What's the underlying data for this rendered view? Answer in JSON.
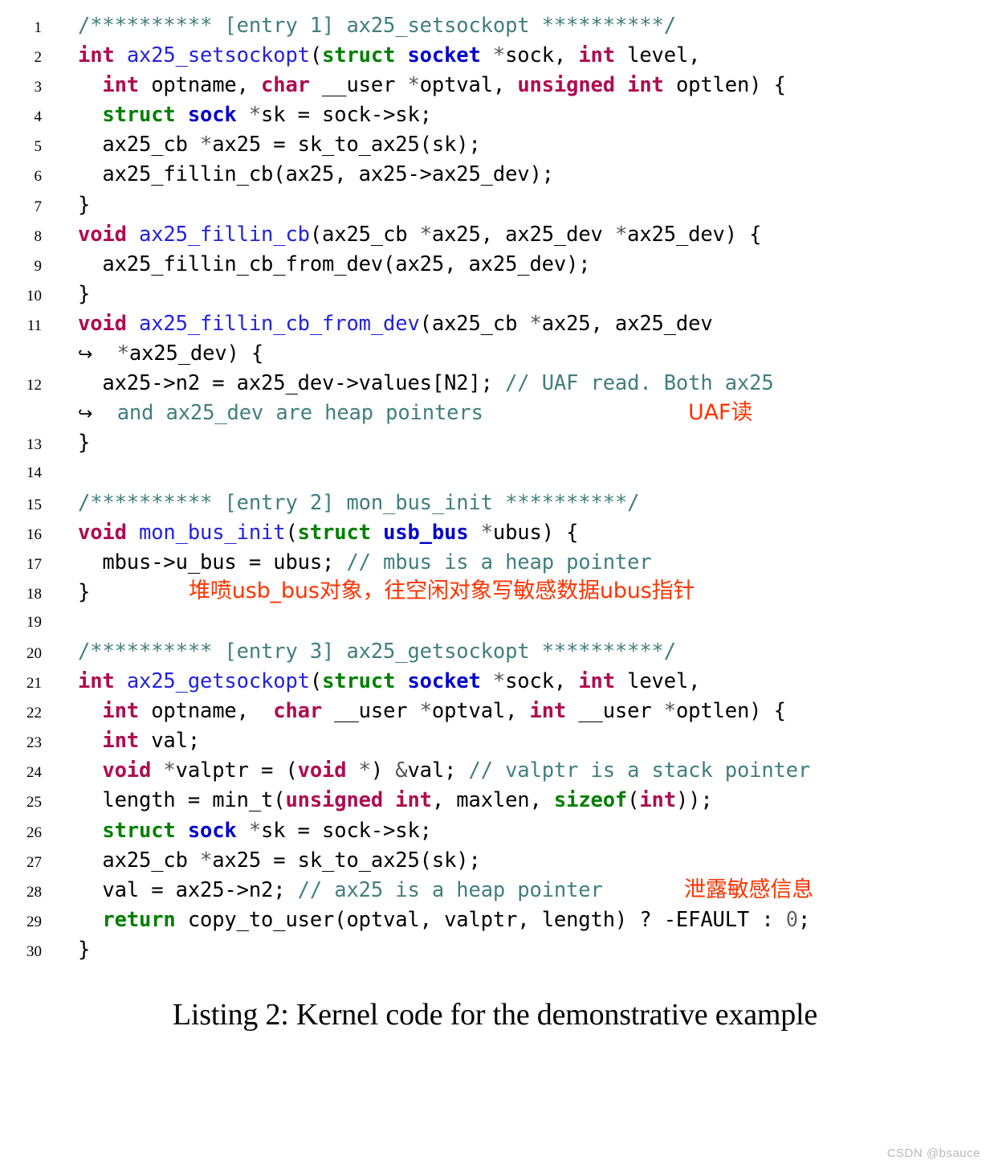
{
  "listing": {
    "caption": "Listing 2: Kernel code for the demonstrative example",
    "watermark": "CSDN @bsauce",
    "continuation_glyph": "↪",
    "colors": {
      "keyword_primitive": "#B00B4F",
      "keyword_struct": "#008000",
      "type_name": "#0000CC",
      "function_name": "#2222DD",
      "comment": "#417E7E",
      "annotation_red": "#FF3300",
      "text": "#000000",
      "background": "#FFFFFF",
      "watermark": "#B9B9B9"
    },
    "lines": [
      {
        "n": "1",
        "segments": [
          {
            "t": "/********** [entry 1] ax25_setsockopt **********/",
            "c": "cm"
          }
        ]
      },
      {
        "n": "2",
        "segments": [
          {
            "t": "int",
            "c": "k"
          },
          {
            "t": " "
          },
          {
            "t": "ax25_setsockopt",
            "c": "fn"
          },
          {
            "t": "("
          },
          {
            "t": "struct",
            "c": "kw"
          },
          {
            "t": " "
          },
          {
            "t": "socket",
            "c": "ty"
          },
          {
            "t": " "
          },
          {
            "t": "*",
            "c": "pt"
          },
          {
            "t": "sock, "
          },
          {
            "t": "int",
            "c": "k"
          },
          {
            "t": " level,"
          }
        ]
      },
      {
        "n": "3",
        "segments": [
          {
            "t": "  "
          },
          {
            "t": "int",
            "c": "k"
          },
          {
            "t": " optname, "
          },
          {
            "t": "char",
            "c": "k"
          },
          {
            "t": " __user "
          },
          {
            "t": "*",
            "c": "pt"
          },
          {
            "t": "optval, "
          },
          {
            "t": "unsigned int",
            "c": "k"
          },
          {
            "t": " optlen) {"
          }
        ]
      },
      {
        "n": "4",
        "segments": [
          {
            "t": "  "
          },
          {
            "t": "struct",
            "c": "kw"
          },
          {
            "t": " "
          },
          {
            "t": "sock",
            "c": "ty"
          },
          {
            "t": " "
          },
          {
            "t": "*",
            "c": "pt"
          },
          {
            "t": "sk = sock->sk;"
          }
        ]
      },
      {
        "n": "5",
        "segments": [
          {
            "t": "  ax25_cb "
          },
          {
            "t": "*",
            "c": "pt"
          },
          {
            "t": "ax25 = sk_to_ax25(sk);"
          }
        ]
      },
      {
        "n": "6",
        "segments": [
          {
            "t": "  ax25_fillin_cb(ax25, ax25->ax25_dev);"
          }
        ]
      },
      {
        "n": "7",
        "segments": [
          {
            "t": "}"
          }
        ]
      },
      {
        "n": "8",
        "segments": [
          {
            "t": "void",
            "c": "k"
          },
          {
            "t": " "
          },
          {
            "t": "ax25_fillin_cb",
            "c": "fn"
          },
          {
            "t": "(ax25_cb "
          },
          {
            "t": "*",
            "c": "pt"
          },
          {
            "t": "ax25, ax25_dev "
          },
          {
            "t": "*",
            "c": "pt"
          },
          {
            "t": "ax25_dev) {"
          }
        ]
      },
      {
        "n": "9",
        "segments": [
          {
            "t": "  ax25_fillin_cb_from_dev(ax25, ax25_dev);"
          }
        ]
      },
      {
        "n": "10",
        "segments": [
          {
            "t": "}"
          }
        ]
      },
      {
        "n": "11",
        "segments": [
          {
            "t": "void",
            "c": "k"
          },
          {
            "t": " "
          },
          {
            "t": "ax25_fillin_cb_from_dev",
            "c": "fn"
          },
          {
            "t": "(ax25_cb "
          },
          {
            "t": "*",
            "c": "pt"
          },
          {
            "t": "ax25, ax25_dev"
          }
        ]
      },
      {
        "n": "",
        "wrap": true,
        "segments": [
          {
            "t": "↪",
            "c": "cont"
          },
          {
            "t": "  "
          },
          {
            "t": "*",
            "c": "pt"
          },
          {
            "t": "ax25_dev) {"
          }
        ]
      },
      {
        "n": "12",
        "segments": [
          {
            "t": "  ax25->n2 = ax25_dev->values[N2]; "
          },
          {
            "t": "// UAF read. Both ax25",
            "c": "cm"
          }
        ]
      },
      {
        "n": "",
        "wrap": true,
        "segments": [
          {
            "t": "↪",
            "c": "cont"
          },
          {
            "t": "  and ax25_dev are heap pointers",
            "c": "cm"
          }
        ],
        "annotation": {
          "text": "UAF读",
          "pos": "ann-uaf"
        }
      },
      {
        "n": "13",
        "segments": [
          {
            "t": "}"
          }
        ]
      },
      {
        "n": "14",
        "segments": [
          {
            "t": ""
          }
        ]
      },
      {
        "n": "15",
        "segments": [
          {
            "t": "/********** [entry 2] mon_bus_init **********/",
            "c": "cm"
          }
        ]
      },
      {
        "n": "16",
        "segments": [
          {
            "t": "void",
            "c": "k"
          },
          {
            "t": " "
          },
          {
            "t": "mon_bus_init",
            "c": "fn"
          },
          {
            "t": "("
          },
          {
            "t": "struct",
            "c": "kw"
          },
          {
            "t": " "
          },
          {
            "t": "usb_bus",
            "c": "ty"
          },
          {
            "t": " "
          },
          {
            "t": "*",
            "c": "pt"
          },
          {
            "t": "ubus) {"
          }
        ]
      },
      {
        "n": "17",
        "segments": [
          {
            "t": "  mbus->u_bus = ubus; "
          },
          {
            "t": "// mbus is a heap pointer",
            "c": "cm"
          }
        ]
      },
      {
        "n": "18",
        "segments": [
          {
            "t": "}"
          }
        ],
        "annotation": {
          "text": "堆喷usb_bus对象，往空闲对象写敏感数据ubus指针",
          "pos": "ann-spray"
        }
      },
      {
        "n": "19",
        "segments": [
          {
            "t": ""
          }
        ]
      },
      {
        "n": "20",
        "segments": [
          {
            "t": "/********** [entry 3] ax25_getsockopt **********/",
            "c": "cm"
          }
        ]
      },
      {
        "n": "21",
        "segments": [
          {
            "t": "int",
            "c": "k"
          },
          {
            "t": " "
          },
          {
            "t": "ax25_getsockopt",
            "c": "fn"
          },
          {
            "t": "("
          },
          {
            "t": "struct",
            "c": "kw"
          },
          {
            "t": " "
          },
          {
            "t": "socket",
            "c": "ty"
          },
          {
            "t": " "
          },
          {
            "t": "*",
            "c": "pt"
          },
          {
            "t": "sock, "
          },
          {
            "t": "int",
            "c": "k"
          },
          {
            "t": " level,"
          }
        ]
      },
      {
        "n": "22",
        "segments": [
          {
            "t": "  "
          },
          {
            "t": "int",
            "c": "k"
          },
          {
            "t": " optname,  "
          },
          {
            "t": "char",
            "c": "k"
          },
          {
            "t": " __user "
          },
          {
            "t": "*",
            "c": "pt"
          },
          {
            "t": "optval, "
          },
          {
            "t": "int",
            "c": "k"
          },
          {
            "t": " __user "
          },
          {
            "t": "*",
            "c": "pt"
          },
          {
            "t": "optlen) {"
          }
        ]
      },
      {
        "n": "23",
        "segments": [
          {
            "t": "  "
          },
          {
            "t": "int",
            "c": "k"
          },
          {
            "t": " val;"
          }
        ]
      },
      {
        "n": "24",
        "segments": [
          {
            "t": "  "
          },
          {
            "t": "void",
            "c": "k"
          },
          {
            "t": " "
          },
          {
            "t": "*",
            "c": "pt"
          },
          {
            "t": "valptr = ("
          },
          {
            "t": "void",
            "c": "k"
          },
          {
            "t": " "
          },
          {
            "t": "*",
            "c": "pt"
          },
          {
            "t": ") "
          },
          {
            "t": "&",
            "c": "pt"
          },
          {
            "t": "val; "
          },
          {
            "t": "// valptr is a stack pointer",
            "c": "cm"
          }
        ]
      },
      {
        "n": "25",
        "segments": [
          {
            "t": "  length = min_t("
          },
          {
            "t": "unsigned int",
            "c": "k"
          },
          {
            "t": ", maxlen, "
          },
          {
            "t": "sizeof",
            "c": "kw"
          },
          {
            "t": "("
          },
          {
            "t": "int",
            "c": "k"
          },
          {
            "t": "));"
          }
        ]
      },
      {
        "n": "26",
        "segments": [
          {
            "t": "  "
          },
          {
            "t": "struct",
            "c": "kw"
          },
          {
            "t": " "
          },
          {
            "t": "sock",
            "c": "ty"
          },
          {
            "t": " "
          },
          {
            "t": "*",
            "c": "pt"
          },
          {
            "t": "sk = sock->sk;"
          }
        ]
      },
      {
        "n": "27",
        "segments": [
          {
            "t": "  ax25_cb "
          },
          {
            "t": "*",
            "c": "pt"
          },
          {
            "t": "ax25 = sk_to_ax25(sk);"
          }
        ]
      },
      {
        "n": "28",
        "segments": [
          {
            "t": "  val = ax25->n2; "
          },
          {
            "t": "// ax25 is a heap pointer",
            "c": "cm"
          }
        ],
        "annotation": {
          "text": "泄露敏感信息",
          "pos": "ann-leak"
        }
      },
      {
        "n": "29",
        "segments": [
          {
            "t": "  "
          },
          {
            "t": "return",
            "c": "kw"
          },
          {
            "t": " copy_to_user(optval, valptr, length) ? -EFAULT : "
          },
          {
            "t": "0",
            "c": "num"
          },
          {
            "t": ";"
          }
        ]
      },
      {
        "n": "30",
        "segments": [
          {
            "t": "}"
          }
        ]
      }
    ]
  }
}
